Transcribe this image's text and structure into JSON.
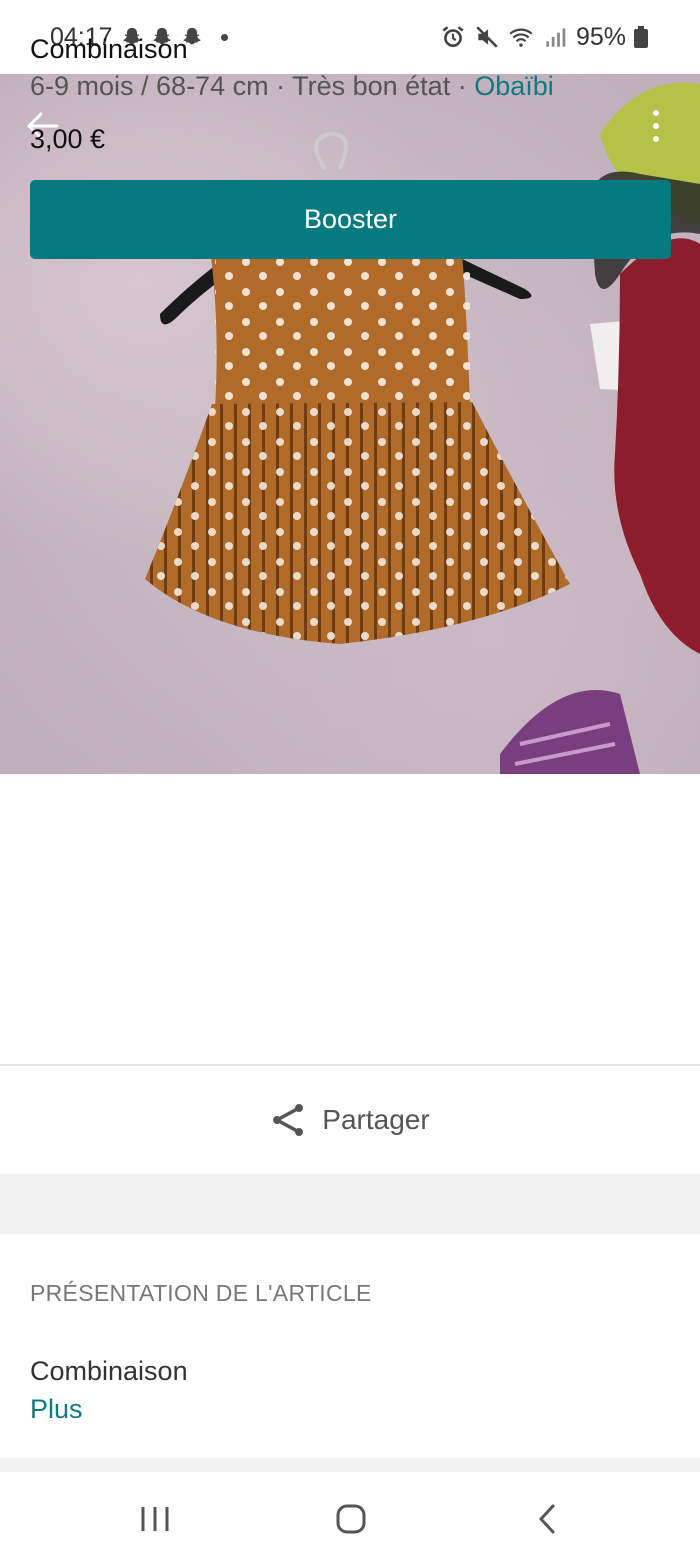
{
  "status_bar": {
    "time": "04:17",
    "battery": "95%"
  },
  "item": {
    "title": "Combinaison",
    "size": "6-9 mois / 68-74 cm",
    "separator": " · ",
    "condition": "Très bon état",
    "brand": "Obaïbi",
    "price": "3,00 €"
  },
  "actions": {
    "booster_label": "Booster",
    "share_label": "Partager"
  },
  "presentation": {
    "section_title": "PRÉSENTATION DE L'ARTICLE",
    "description": "Combinaison",
    "more_label": "Plus"
  },
  "colors": {
    "accent": "#077a80",
    "link": "#117a80"
  }
}
